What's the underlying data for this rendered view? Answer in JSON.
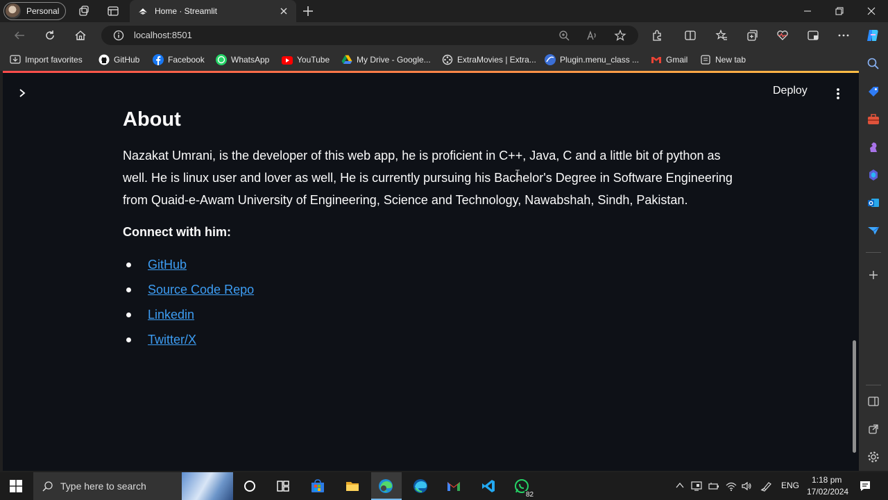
{
  "browser": {
    "profile_label": "Personal",
    "tab_title": "Home · Streamlit",
    "url": "localhost:8501"
  },
  "bookmarks": [
    {
      "label": "Import favorites",
      "icon": "import-favorites-icon"
    },
    {
      "label": "GitHub",
      "icon": "github-icon"
    },
    {
      "label": "Facebook",
      "icon": "facebook-icon"
    },
    {
      "label": "WhatsApp",
      "icon": "whatsapp-icon"
    },
    {
      "label": "YouTube",
      "icon": "youtube-icon"
    },
    {
      "label": "My Drive - Google...",
      "icon": "google-drive-icon"
    },
    {
      "label": "ExtraMovies | Extra...",
      "icon": "extramovies-icon"
    },
    {
      "label": "Plugin.menu_class ...",
      "icon": "plugin-icon"
    },
    {
      "label": "Gmail",
      "icon": "gmail-icon"
    },
    {
      "label": "New tab",
      "icon": "new-tab-icon"
    }
  ],
  "app": {
    "deploy_label": "Deploy",
    "heading": "About",
    "paragraph": "Nazakat Umrani, is the developer of this web app, he is proficient in C++, Java, C and a little bit of python as well. He is linux user and lover as well, He is currently pursuing his Bachelor's Degree in Software Engineering from Quaid-e-Awam University of Engineering, Science and Technology, Nawabshah, Sindh, Pakistan.",
    "connect_heading": "Connect with him:",
    "links": [
      {
        "label": "GitHub"
      },
      {
        "label": "Source Code Repo"
      },
      {
        "label": "Linkedin"
      },
      {
        "label": "Twitter/X"
      }
    ]
  },
  "taskbar": {
    "search_placeholder": "Type here to search",
    "whatsapp_badge": "82",
    "language": "ENG",
    "time": "1:18 pm",
    "date": "17/02/2024"
  },
  "colors": {
    "page_bg": "#0e1117",
    "link": "#3d9df3",
    "accent_gradient_start": "#ff4b4b",
    "accent_gradient_end": "#ffbd45"
  }
}
